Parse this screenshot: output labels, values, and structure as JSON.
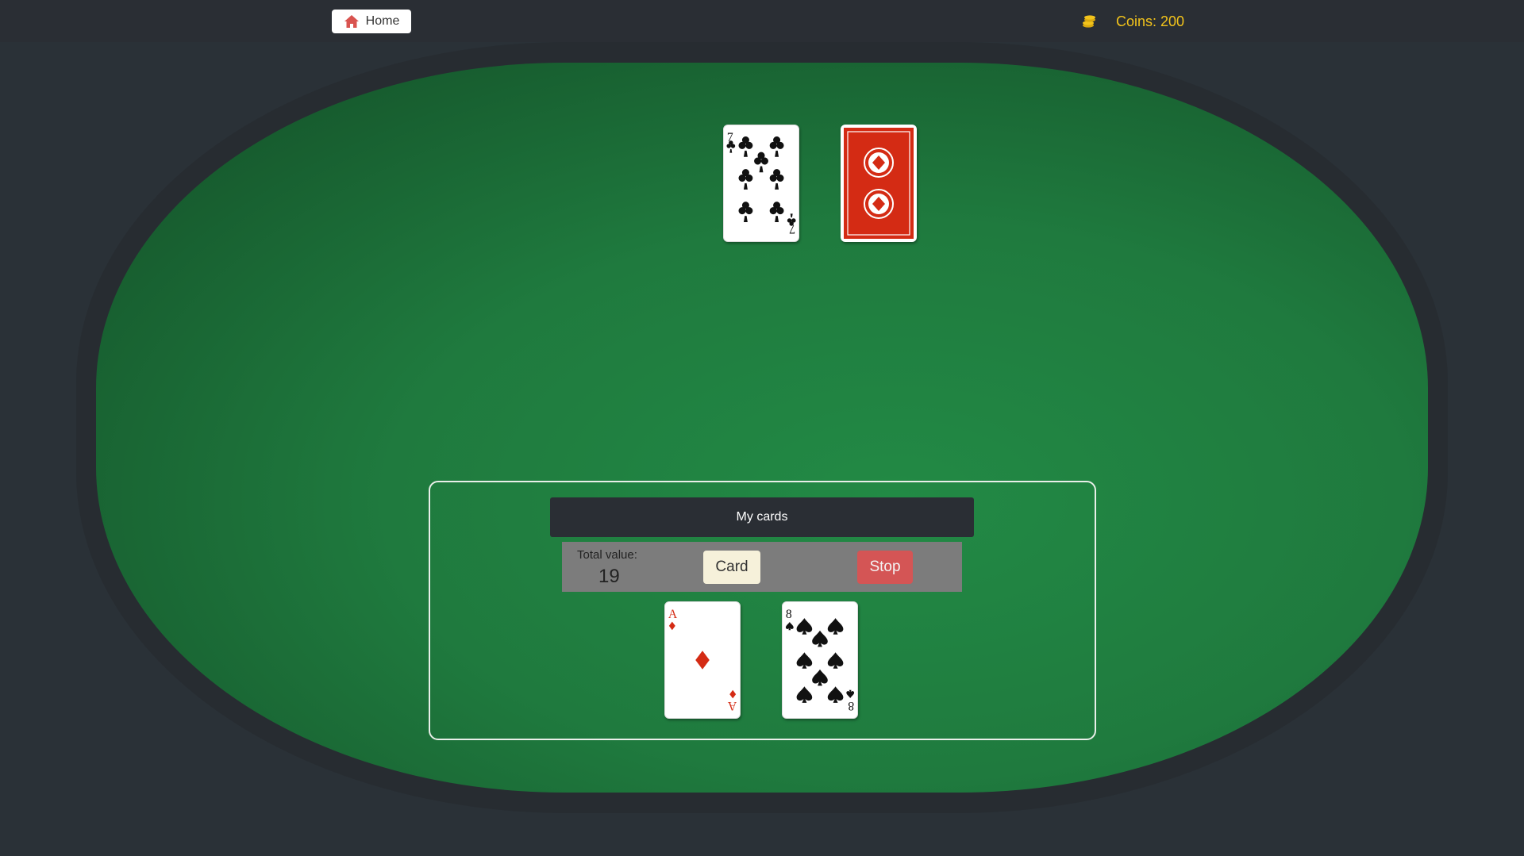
{
  "header": {
    "home_label": "Home",
    "home_icon": "home-icon",
    "coins_icon": "coins-icon",
    "coins_text": "Coins: 200"
  },
  "dealer": {
    "cards": [
      {
        "rank": "7",
        "suit": "clubs",
        "face_up": true
      },
      {
        "face_up": false
      }
    ]
  },
  "player": {
    "section_title": "My cards",
    "total_label": "Total value:",
    "total_value": "19",
    "card_button": "Card",
    "stop_button": "Stop",
    "cards": [
      {
        "rank": "A",
        "suit": "diamonds",
        "face_up": true
      },
      {
        "rank": "8",
        "suit": "spades",
        "face_up": true
      }
    ]
  },
  "colors": {
    "felt": "#1f7a3e",
    "rim": "#272c31",
    "topbar": "#2a2e34",
    "coins": "#f2c31b",
    "card_back": "#d42b14",
    "stop": "#d45555",
    "card_btn": "#f6f1da"
  }
}
